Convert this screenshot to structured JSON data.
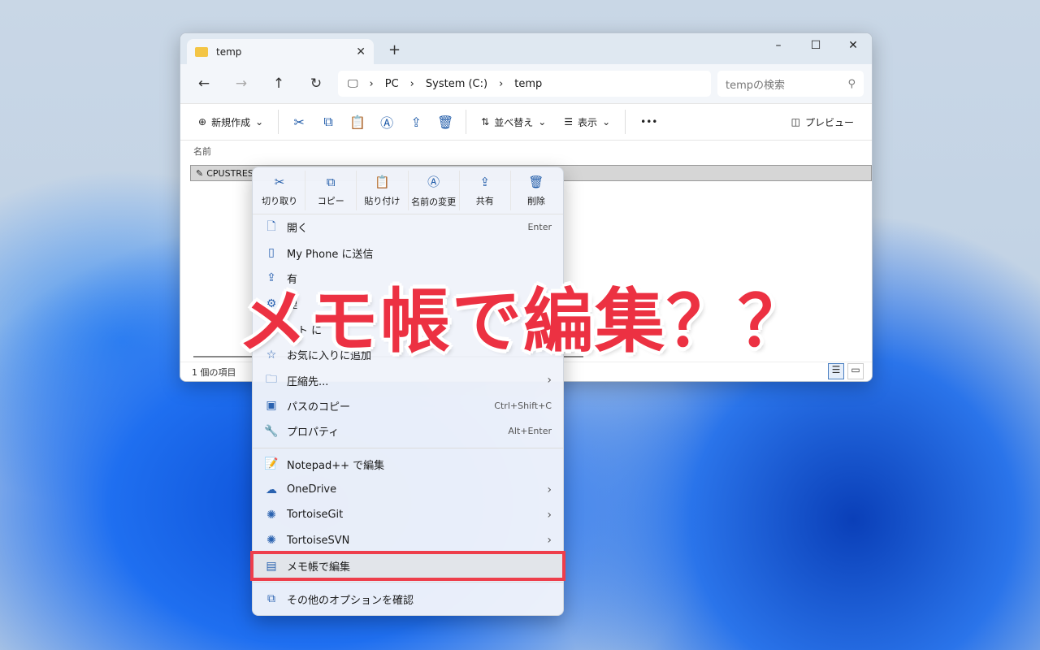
{
  "window": {
    "tab_title": "temp",
    "new_tab": "+",
    "controls": {
      "minimize": "–",
      "maximize": "☐",
      "close": "✕"
    }
  },
  "nav": {
    "back": "←",
    "forward": "→",
    "up": "↑",
    "refresh": "↻"
  },
  "breadcrumb": [
    "PC",
    "System (C:)",
    "temp"
  ],
  "search": {
    "placeholder": "tempの検索"
  },
  "toolbar": {
    "new": "新規作成",
    "sort": "並べ替え",
    "view": "表示",
    "more": "•••",
    "preview": "プレビュー"
  },
  "list": {
    "column_name": "名前",
    "files": [
      {
        "name": "CPUSTRES"
      }
    ]
  },
  "status": {
    "count": "1 個の項目"
  },
  "context_menu": {
    "quick_actions": [
      {
        "label": "切り取り",
        "icon": "cut-icon"
      },
      {
        "label": "コピー",
        "icon": "copy-icon"
      },
      {
        "label": "貼り付け",
        "icon": "paste-icon"
      },
      {
        "label": "名前の変更",
        "icon": "rename-icon"
      },
      {
        "label": "共有",
        "icon": "share-icon"
      },
      {
        "label": "削除",
        "icon": "delete-icon"
      }
    ],
    "group1": [
      {
        "label": "開く",
        "shortcut": "Enter",
        "icon": "open-icon"
      },
      {
        "label": "My Phone に送信",
        "icon": "phone-icon"
      },
      {
        "label": "有",
        "icon": "share-icon"
      },
      {
        "label": "理",
        "icon": "manage-icon"
      },
      {
        "label": "ート に",
        "icon": "pin-icon"
      },
      {
        "label": "お気に入りに追加",
        "icon": "star-icon"
      },
      {
        "label": "圧縮先...",
        "submenu": true,
        "icon": "zip-icon"
      },
      {
        "label": "パスのコピー",
        "shortcut": "Ctrl+Shift+C",
        "icon": "path-icon"
      },
      {
        "label": "プロパティ",
        "shortcut": "Alt+Enter",
        "icon": "wrench-icon"
      }
    ],
    "group2": [
      {
        "label": "Notepad++ で編集",
        "icon": "notepadpp-icon"
      },
      {
        "label": "OneDrive",
        "submenu": true,
        "icon": "cloud-icon"
      },
      {
        "label": "TortoiseGit",
        "submenu": true,
        "icon": "tortoise-icon"
      },
      {
        "label": "TortoiseSVN",
        "submenu": true,
        "icon": "tortoise-icon"
      },
      {
        "label": "メモ帳で編集",
        "icon": "notepad-icon",
        "highlighted": true
      }
    ],
    "more_options": "その他のオプションを確認"
  },
  "overlay_caption": "メモ帳で編集？？",
  "colors": {
    "highlight": "#ee3e4b",
    "caption": "#ec3142",
    "accent": "#1e5aa8"
  }
}
